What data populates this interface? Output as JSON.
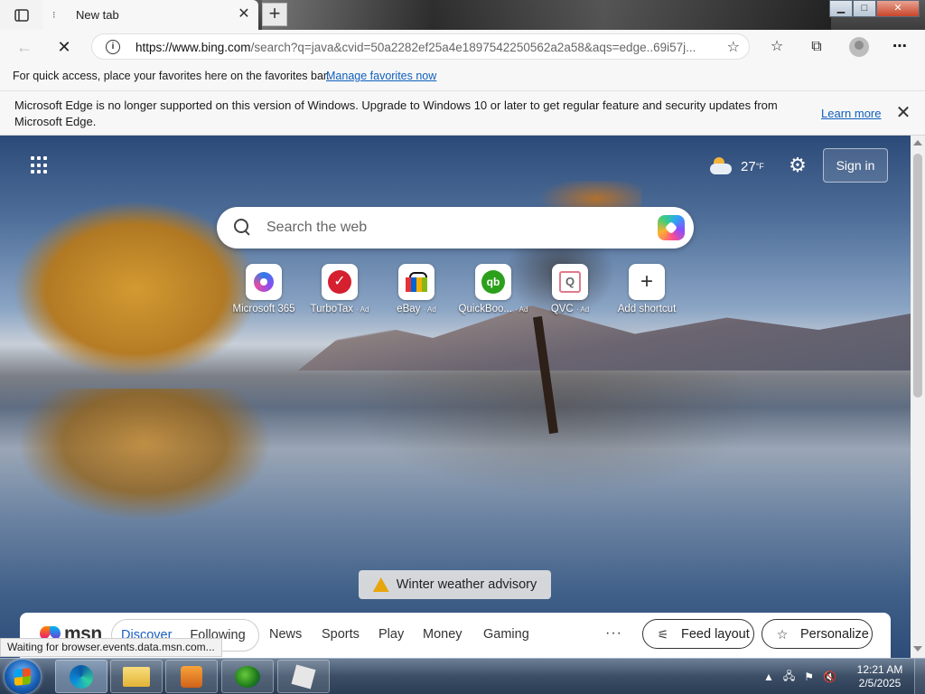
{
  "browser": {
    "tab": {
      "title": "New tab"
    },
    "newtab_symbol": "+",
    "window_controls": {
      "minimize": "▁",
      "maximize": "□",
      "close": "✕"
    },
    "address": {
      "host": "https://www.bing.com",
      "rest": "/search?q=java&cvid=50a2282ef25a4e1897542250562a2a58&aqs=edge..69i57j..."
    },
    "favorites_bar": {
      "message": "For quick access, place your favorites here on the favorites bar.",
      "link": "Manage favorites now"
    },
    "infobar": {
      "message": "Microsoft Edge is no longer supported on this version of Windows. Upgrade to Windows 10 or later to get regular feature and security updates from Microsoft Edge.",
      "link": "Learn more"
    }
  },
  "ntp": {
    "weather": {
      "temp": "27",
      "unit": "°F"
    },
    "signin": "Sign in",
    "search": {
      "placeholder": "Search the web"
    },
    "shortcuts": [
      {
        "label": "Microsoft 365",
        "ad": ""
      },
      {
        "label": "TurboTax",
        "ad": "· Ad"
      },
      {
        "label": "eBay",
        "ad": "· Ad"
      },
      {
        "label": "QuickBoo...",
        "ad": "· Ad"
      },
      {
        "label": "QVC",
        "ad": "· Ad"
      },
      {
        "label": "Add shortcut",
        "ad": ""
      }
    ],
    "shortcut_glyphs": {
      "turbotax": "✓",
      "quickbooks": "qb",
      "qvc": "Q",
      "add": "+"
    },
    "advisory": "Winter weather advisory",
    "msn": {
      "logo": "msn",
      "feed_tabs": [
        "Discover",
        "Following"
      ],
      "categories": [
        "News",
        "Sports",
        "Play",
        "Money",
        "Gaming"
      ],
      "more": "···",
      "feed_layout": "Feed layout",
      "personalize": "Personalize"
    }
  },
  "status_text": "Waiting for browser.events.data.msn.com...",
  "taskbar": {
    "clock": {
      "time": "12:21 AM",
      "date": "2/5/2025"
    }
  }
}
